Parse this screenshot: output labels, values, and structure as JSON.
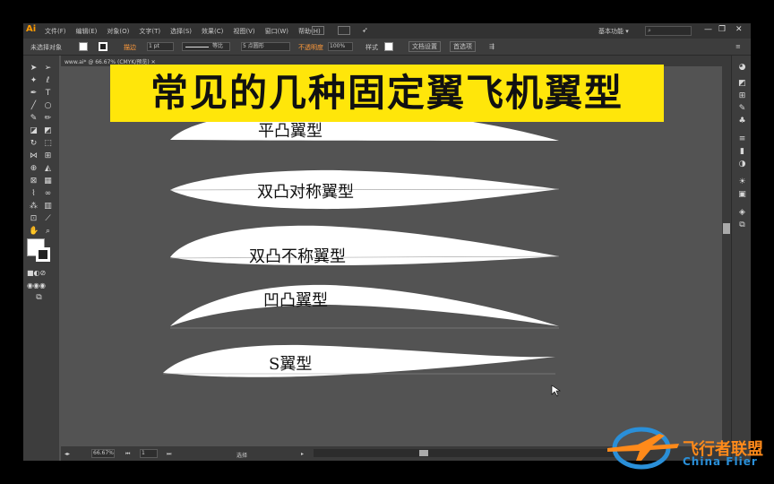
{
  "app": {
    "logo": "Ai",
    "menu": [
      "文件(F)",
      "编辑(E)",
      "对象(O)",
      "文字(T)",
      "选择(S)",
      "效果(C)",
      "视图(V)",
      "窗口(W)",
      "帮助(H)"
    ],
    "workspace_label": "基本功能",
    "workspace_caret": "▾",
    "min_glyph": "—",
    "restore_glyph": "❐",
    "close_glyph": "✕"
  },
  "control_bar": {
    "selection_status": "未选择对象",
    "stroke_label": "描边",
    "stroke_weight": "1 pt",
    "stroke_profile": "等比",
    "brush": "5 点圆形",
    "opacity_label": "不透明度",
    "opacity_value": "100%",
    "style_label": "样式",
    "doc_setup_button": "文档设置",
    "preferences_button": "首选项"
  },
  "document_tab": {
    "name": "www.ai* @ 66.67% (CMYK/预览)",
    "close_glyph": "✕"
  },
  "status_bar": {
    "zoom": "66.67%",
    "page": "1",
    "tool_status": "选择"
  },
  "banner": {
    "title": "常见的几种固定翼飞机翼型"
  },
  "airfoils": [
    {
      "label": "平凸翼型"
    },
    {
      "label": "双凸对称翼型"
    },
    {
      "label": "双凸不称翼型"
    },
    {
      "label": "凹凸翼型"
    },
    {
      "label": "S翼型"
    }
  ],
  "watermark": {
    "text": "飞行者联盟",
    "english": "China Flier"
  },
  "colors": {
    "banner_bg": "#ffe60a",
    "canvas_bg": "#535353",
    "panel_bg": "#3d3d3d",
    "logo": "#ff9a00",
    "watermark_orange": "#ff8a1a",
    "watermark_blue": "#2a8fd8"
  }
}
